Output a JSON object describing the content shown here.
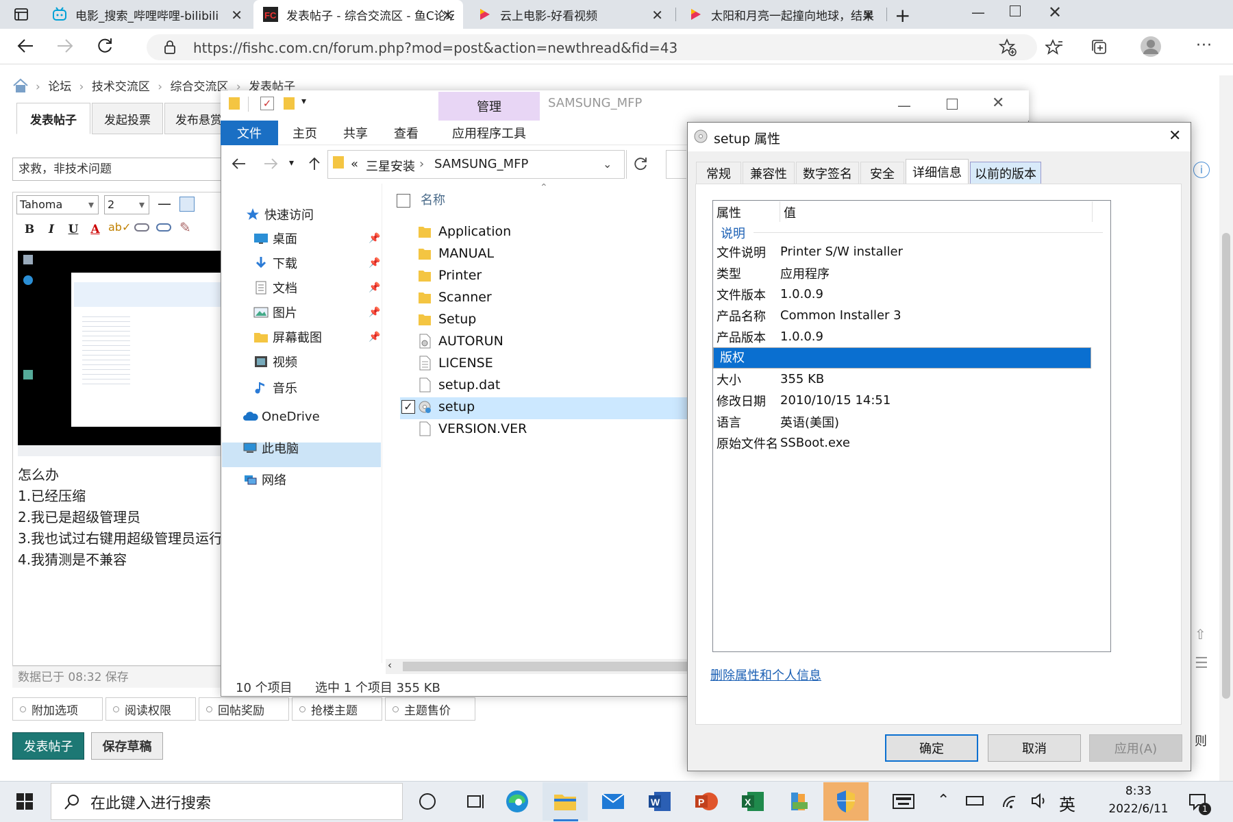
{
  "browser": {
    "tabs": [
      {
        "label": "电影_搜索_哔哩哔哩-bilibili",
        "icon": "bilibili-icon"
      },
      {
        "label": "发表帖子 - 综合交流区 - 鱼C论坛",
        "icon": "fishc-icon"
      },
      {
        "label": "云上电影-好看视频",
        "icon": "haokan-icon"
      },
      {
        "label": "太阳和月亮一起撞向地球，结果",
        "icon": "haokan-icon"
      }
    ],
    "url": "https://fishc.com.cn/forum.php?mod=post&action=newthread&fid=43"
  },
  "forum": {
    "breadcrumb": [
      "论坛",
      "技术交流区",
      "综合交流区",
      "发表帖子"
    ],
    "tabs": [
      "发表帖子",
      "发起投票",
      "发布悬赏"
    ],
    "subject": "求救，非技术问题",
    "font_name": "Tahoma",
    "font_size": "2",
    "format_buttons": [
      "B",
      "I",
      "U",
      "A"
    ],
    "body_lines": [
      "怎么办",
      "1.已经压缩",
      "2.我已是超级管理员",
      "3.我也试过右键用超级管理员运行",
      "4.我猜测是不兼容"
    ],
    "autosave": "数据已于 08:32 保存",
    "options": [
      "附加选项",
      "阅读权限",
      "回帖奖励",
      "抢楼主题",
      "主题售价"
    ],
    "post_button": "发表帖子",
    "draft_button": "保存草稿",
    "side_text_1": "则"
  },
  "explorer": {
    "context_tab": "管理",
    "caption": "SAMSUNG_MFP",
    "menu": [
      "文件",
      "主页",
      "共享",
      "查看",
      "应用程序工具"
    ],
    "path_prefix": "«",
    "path": [
      "三星安装",
      "SAMSUNG_MFP"
    ],
    "nav": [
      {
        "label": "快速访问",
        "icon": "star-icon"
      },
      {
        "label": "桌面",
        "icon": "desktop-icon",
        "pinned": true
      },
      {
        "label": "下载",
        "icon": "download-icon",
        "pinned": true
      },
      {
        "label": "文档",
        "icon": "document-icon",
        "pinned": true
      },
      {
        "label": "图片",
        "icon": "picture-icon",
        "pinned": true
      },
      {
        "label": "屏幕截图",
        "icon": "folder-icon",
        "pinned": true
      },
      {
        "label": "视频",
        "icon": "video-icon"
      },
      {
        "label": "音乐",
        "icon": "music-icon"
      },
      {
        "label": "OneDrive",
        "icon": "cloud-icon"
      },
      {
        "label": "此电脑",
        "icon": "computer-icon"
      },
      {
        "label": "网络",
        "icon": "network-icon"
      }
    ],
    "column_name": "名称",
    "files": [
      {
        "name": "Application",
        "type": "folder"
      },
      {
        "name": "MANUAL",
        "type": "folder"
      },
      {
        "name": "Printer",
        "type": "folder"
      },
      {
        "name": "Scanner",
        "type": "folder"
      },
      {
        "name": "Setup",
        "type": "folder"
      },
      {
        "name": "AUTORUN",
        "type": "autorun"
      },
      {
        "name": "LICENSE",
        "type": "text"
      },
      {
        "name": "setup.dat",
        "type": "file"
      },
      {
        "name": "setup",
        "type": "setup",
        "selected": true
      },
      {
        "name": "VERSION.VER",
        "type": "file"
      }
    ],
    "status_count": "10 个项目",
    "status_selected": "选中 1 个项目  355 KB"
  },
  "dialog": {
    "title": "setup 属性",
    "tabs": [
      "常规",
      "兼容性",
      "数字签名",
      "安全",
      "详细信息",
      "以前的版本"
    ],
    "active_tab": "详细信息",
    "col_property": "属性",
    "col_value": "值",
    "section": "说明",
    "rows": [
      {
        "k": "文件说明",
        "v": "Printer S/W installer"
      },
      {
        "k": "类型",
        "v": "应用程序"
      },
      {
        "k": "文件版本",
        "v": "1.0.0.9"
      },
      {
        "k": "产品名称",
        "v": "Common Installer 3"
      },
      {
        "k": "产品版本",
        "v": "1.0.0.9"
      },
      {
        "k": "版权",
        "v": "",
        "selected": true
      },
      {
        "k": "大小",
        "v": "355 KB"
      },
      {
        "k": "修改日期",
        "v": "2010/10/15 14:51"
      },
      {
        "k": "语言",
        "v": "英语(美国)"
      },
      {
        "k": "原始文件名",
        "v": "SSBoot.exe"
      }
    ],
    "link": "删除属性和个人信息",
    "ok": "确定",
    "cancel": "取消",
    "apply": "应用(A)"
  },
  "taskbar": {
    "search_placeholder": "在此键入进行搜索",
    "ime": "英",
    "time": "8:33",
    "date": "2022/6/11",
    "notification_count": "1"
  },
  "colors": {
    "accent": "#0a6fd0",
    "file_menu": "#1a6fc4",
    "ribbon_context": "#e8d6f5",
    "post_button": "#1d7874"
  }
}
